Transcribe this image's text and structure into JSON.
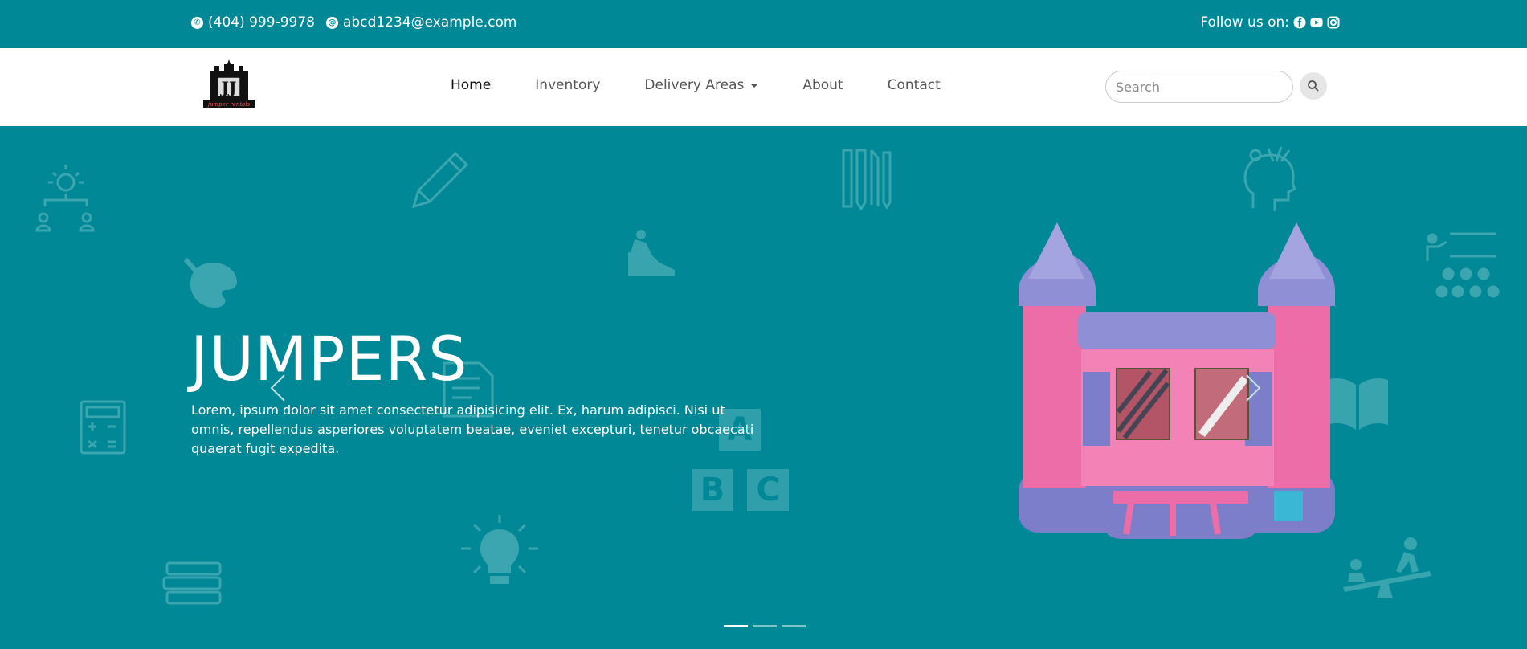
{
  "topbar": {
    "phone": "(404) 999-9978",
    "email": "abcd1234@example.com",
    "follow_label": "Follow us on:",
    "social_icons": [
      "facebook-icon",
      "youtube-icon",
      "instagram-icon"
    ]
  },
  "navbar": {
    "logo_text": "JJ",
    "logo_caption": "jumper rentals",
    "items": [
      {
        "label": "Home",
        "active": true
      },
      {
        "label": "Inventory",
        "active": false
      },
      {
        "label": "Delivery Areas",
        "dropdown": true
      },
      {
        "label": "About",
        "active": false
      },
      {
        "label": "Contact",
        "active": false
      }
    ],
    "search_placeholder": "Search"
  },
  "hero": {
    "title": "JUMPERS",
    "description": "Lorem, ipsum dolor sit amet consectetur adipisicing elit. Ex, harum adipisci. Nisi ut omnis, repellendus asperiores voluptatem beatae, eveniet excepturi, tenetur obcaecati quaerat fugit expedita.",
    "abc_letters": [
      "A",
      "B",
      "C"
    ],
    "slide_count": 3,
    "active_slide": 1
  },
  "colors": {
    "primary": "#008896",
    "deco": "#4fb0b9",
    "navbar_bg": "#ffffff",
    "castle_pink": "#ee6fa6",
    "castle_purple": "#8f8fd6"
  }
}
